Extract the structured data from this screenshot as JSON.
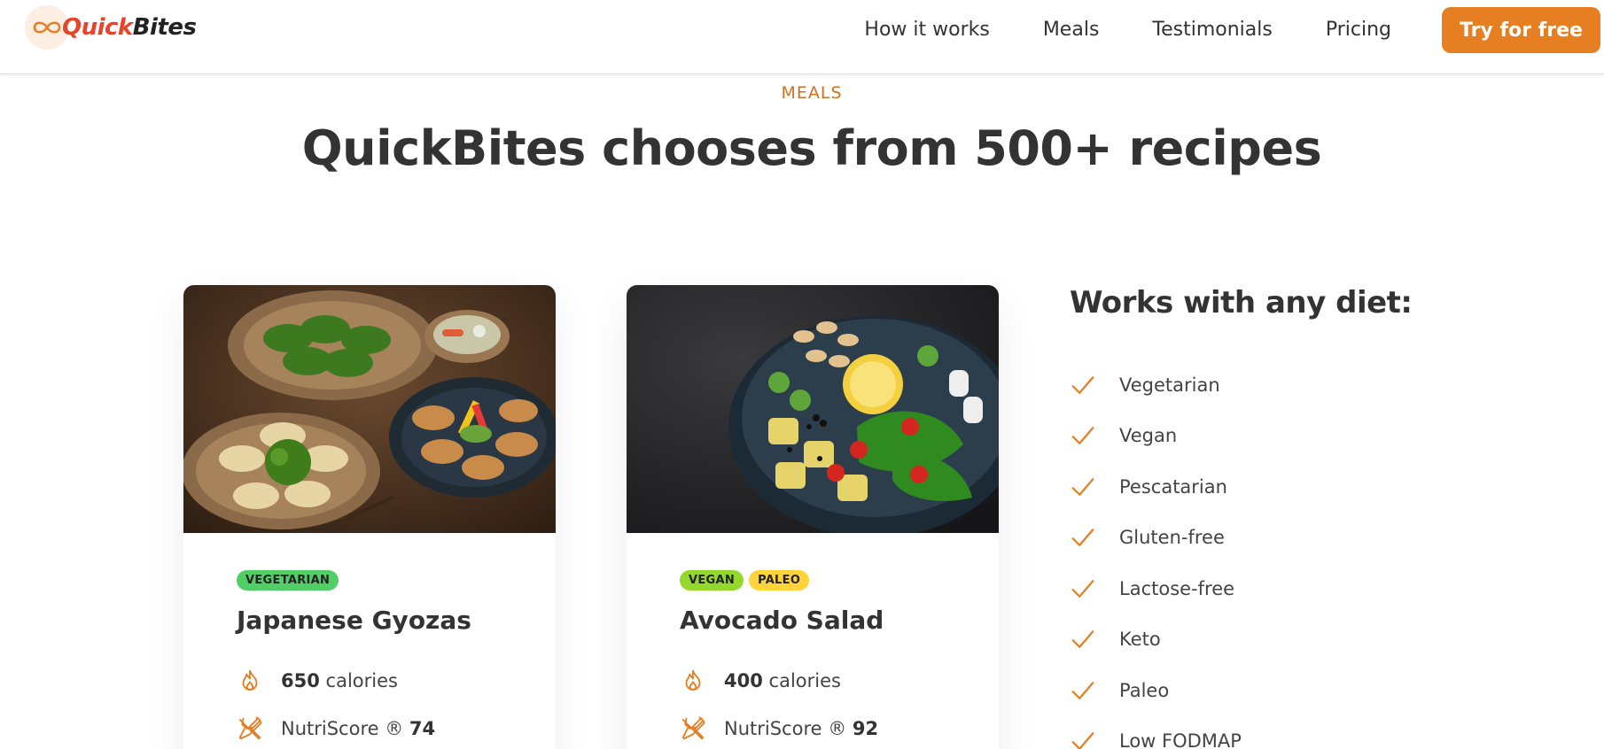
{
  "header": {
    "logo": {
      "part1": "Quick",
      "part2": "Bites"
    },
    "nav": [
      "How it works",
      "Meals",
      "Testimonials",
      "Pricing"
    ],
    "cta": "Try for free"
  },
  "section": {
    "eyebrow": "MEALS",
    "title": "QuickBites chooses from 500+ recipes"
  },
  "meals": [
    {
      "tags": [
        "VEGETARIAN"
      ],
      "name": "Japanese Gyozas",
      "calories": "650",
      "calories_label": "calories",
      "nutri_label": "NutriScore ®",
      "nutri": "74",
      "image": "gyozas-photo"
    },
    {
      "tags": [
        "VEGAN",
        "PALEO"
      ],
      "name": "Avocado Salad",
      "calories": "400",
      "calories_label": "calories",
      "nutri_label": "NutriScore ®",
      "nutri": "92",
      "image": "avocado-salad-photo"
    }
  ],
  "diets": {
    "title": "Works with any diet:",
    "items": [
      "Vegetarian",
      "Vegan",
      "Pescatarian",
      "Gluten-free",
      "Lactose-free",
      "Keto",
      "Paleo",
      "Low FODMAP"
    ]
  },
  "colors": {
    "accent": "#e67e22",
    "accent_dark": "#cf711f",
    "text": "#333333",
    "tag_vegetarian": "#51cf66",
    "tag_vegan": "#94d82d",
    "tag_paleo": "#ffd43b"
  },
  "icons": {
    "calories": "flame-icon",
    "nutriscore": "utensils-icon",
    "diet_check": "checkmark-icon",
    "logo": "infinity-icon"
  }
}
